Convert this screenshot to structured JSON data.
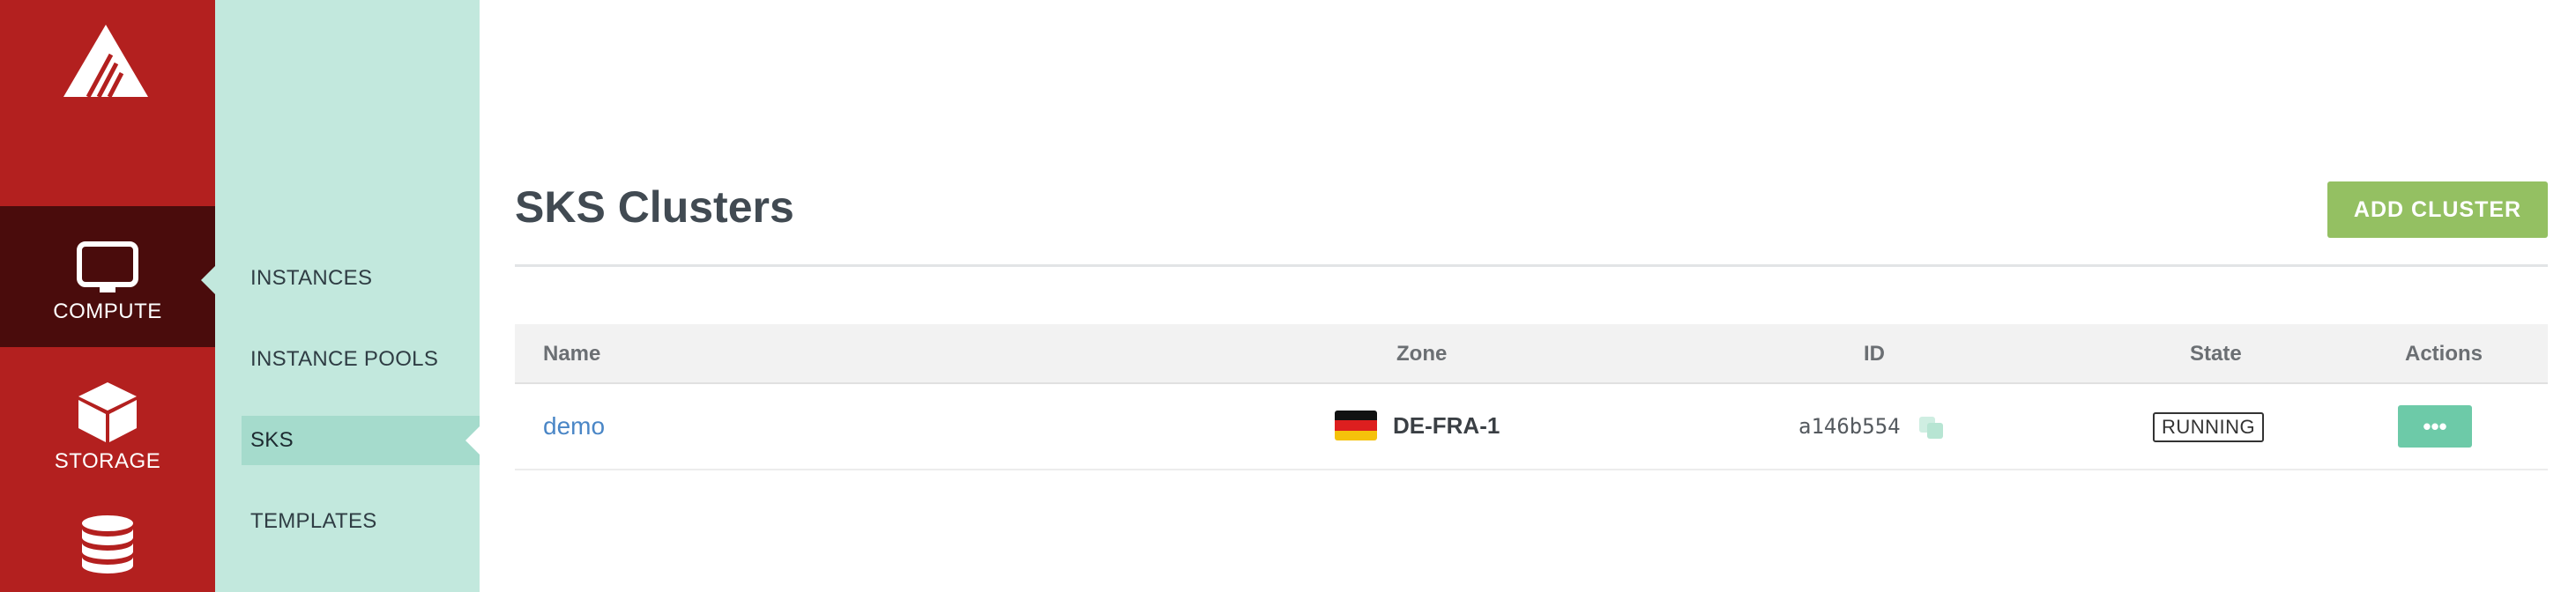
{
  "rail": {
    "items": [
      {
        "label": "COMPUTE",
        "icon": "monitor-icon"
      },
      {
        "label": "STORAGE",
        "icon": "cube-icon"
      },
      {
        "label": "",
        "icon": "database-icon"
      }
    ]
  },
  "submenu": {
    "items": [
      {
        "label": "INSTANCES"
      },
      {
        "label": "INSTANCE POOLS"
      },
      {
        "label": "SKS"
      },
      {
        "label": "TEMPLATES"
      }
    ]
  },
  "main": {
    "title": "SKS Clusters",
    "add_button": "ADD CLUSTER",
    "table": {
      "columns": [
        "Name",
        "Zone",
        "ID",
        "State",
        "Actions"
      ],
      "rows": [
        {
          "name": "demo",
          "zone": "DE-FRA-1",
          "id": "a146b554",
          "state": "RUNNING",
          "action": "•••"
        }
      ]
    }
  },
  "colors": {
    "rail": "#b3201f",
    "rail_active": "#4a0c0c",
    "submenu": "#c2e8dd",
    "submenu_active": "#a5dbcc",
    "add_button": "#94c062",
    "action_button": "#6dcaa8",
    "link": "#4a86c6"
  }
}
